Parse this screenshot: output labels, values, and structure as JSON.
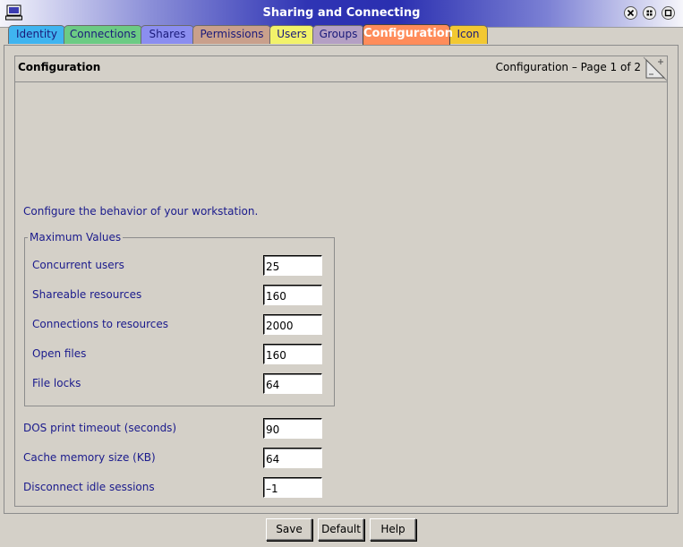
{
  "window": {
    "title": "Sharing and Connecting"
  },
  "tabs": [
    {
      "label": "Identity",
      "color": "#3fb4f0"
    },
    {
      "label": "Connections",
      "color": "#6ccb84"
    },
    {
      "label": "Shares",
      "color": "#8b8ef0"
    },
    {
      "label": "Permissions",
      "color": "#c9a08c"
    },
    {
      "label": "Users",
      "color": "#f2f26a"
    },
    {
      "label": "Groups",
      "color": "#b4a0c4"
    },
    {
      "label": "Configuration",
      "color": "#ff8c5a",
      "active": true
    },
    {
      "label": "Icon",
      "color": "#f2c832"
    }
  ],
  "page": {
    "title": "Configuration",
    "indicator": "Configuration – Page 1 of 2"
  },
  "description": "Configure the behavior of your workstation.",
  "max_values": {
    "title": "Maximum Values",
    "fields": [
      {
        "label": "Concurrent users",
        "value": "25"
      },
      {
        "label": "Shareable resources",
        "value": "160"
      },
      {
        "label": "Connections to resources",
        "value": "2000"
      },
      {
        "label": "Open files",
        "value": "160"
      },
      {
        "label": "File locks",
        "value": "64"
      }
    ]
  },
  "other_fields": [
    {
      "label": "DOS print timeout (seconds)",
      "value": "90"
    },
    {
      "label": "Cache memory size (KB)",
      "value": "64"
    },
    {
      "label": "Disconnect idle sessions",
      "value": "–1"
    }
  ],
  "buttons": {
    "save": "Save",
    "default": "Default",
    "help": "Help"
  }
}
